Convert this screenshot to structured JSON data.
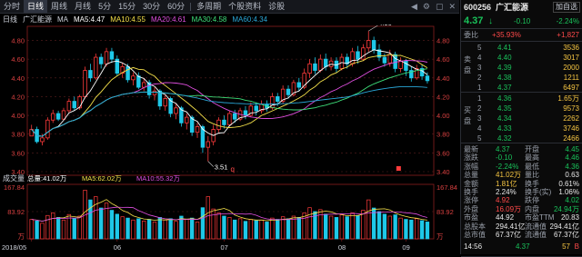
{
  "toolbar": {
    "tabs": [
      "分时",
      "日线",
      "周线",
      "月线",
      "5分",
      "15分",
      "30分",
      "60分",
      "多周期",
      "个股资料",
      "诊股"
    ],
    "active_index": 1
  },
  "info": {
    "period": "日线",
    "name": "广汇能源",
    "ma_label": "MA",
    "ma5": "MA5:4.47",
    "ma10": "MA10:4.55",
    "ma20": "MA20:4.61",
    "ma30": "MA30:4.58",
    "ma60": "MA60:4.34"
  },
  "colors": {
    "up": "#ff3b3b",
    "down": "#1ec8e8",
    "ma5": "#ffffff",
    "ma10": "#f5e14a",
    "ma20": "#e04fe0",
    "ma30": "#3ee07a",
    "ma60": "#2aa7d8"
  },
  "chart_data": {
    "type": "candlestick",
    "price_axis": [
      "4.80",
      "4.60",
      "4.40",
      "4.20",
      "4.00",
      "3.80",
      "3.60",
      "3.40"
    ],
    "price_axis_right": [
      "4.80",
      "4.60",
      "4.40",
      "4.20",
      "4.00",
      "3.80",
      "3.60",
      "3.40"
    ],
    "annotations": {
      "high": "4.90",
      "low": "3.51",
      "marker": "q"
    },
    "volume_title": "成交量",
    "volume_stats": {
      "vol": "总量:41.02万",
      "ma5": "MA5:62.02万",
      "ma10": "MA10:55.32万"
    },
    "volume_axis": [
      "167.84",
      "83.92",
      "万"
    ],
    "volume_axis_right": [
      "167.84",
      "83.92",
      "万"
    ],
    "x_labels": [
      "2018/05",
      "06",
      "07",
      "08",
      "09"
    ],
    "candles": [
      [
        3.78,
        3.85,
        3.82,
        3.9
      ],
      [
        3.85,
        3.72,
        3.7,
        3.88
      ],
      [
        3.72,
        3.76,
        3.68,
        3.8
      ],
      [
        3.76,
        3.95,
        3.74,
        3.98
      ],
      [
        3.95,
        4.02,
        3.92,
        4.06
      ],
      [
        4.02,
        3.96,
        3.94,
        4.05
      ],
      [
        3.96,
        4.05,
        3.95,
        4.08
      ],
      [
        4.05,
        4.15,
        4.02,
        4.18
      ],
      [
        4.15,
        4.08,
        4.05,
        4.2
      ],
      [
        4.08,
        4.2,
        4.06,
        4.22
      ],
      [
        4.2,
        4.48,
        4.18,
        4.52
      ],
      [
        4.48,
        4.4,
        4.36,
        4.55
      ],
      [
        4.4,
        4.62,
        4.38,
        4.66
      ],
      [
        4.62,
        4.55,
        4.5,
        4.66
      ],
      [
        4.55,
        4.68,
        4.52,
        4.72
      ],
      [
        4.68,
        4.6,
        4.56,
        4.72
      ],
      [
        4.6,
        4.45,
        4.42,
        4.64
      ],
      [
        4.45,
        4.52,
        4.4,
        4.56
      ],
      [
        4.52,
        4.38,
        4.35,
        4.55
      ],
      [
        4.38,
        4.42,
        4.32,
        4.46
      ],
      [
        4.42,
        4.3,
        4.28,
        4.46
      ],
      [
        4.3,
        4.35,
        4.26,
        4.4
      ],
      [
        4.35,
        4.22,
        4.18,
        4.38
      ],
      [
        4.22,
        4.26,
        4.16,
        4.3
      ],
      [
        4.26,
        4.1,
        4.06,
        4.28
      ],
      [
        4.1,
        4.18,
        4.05,
        4.22
      ],
      [
        4.18,
        4.02,
        3.98,
        4.2
      ],
      [
        4.02,
        4.08,
        3.96,
        4.12
      ],
      [
        4.08,
        3.92,
        3.88,
        4.1
      ],
      [
        3.92,
        3.98,
        3.85,
        4.02
      ],
      [
        3.98,
        3.82,
        3.78,
        4.0
      ],
      [
        3.82,
        3.88,
        3.76,
        3.92
      ],
      [
        3.88,
        3.66,
        3.6,
        3.9
      ],
      [
        3.66,
        3.72,
        3.51,
        3.78
      ],
      [
        3.72,
        3.85,
        3.68,
        3.9
      ],
      [
        3.85,
        3.95,
        3.82,
        3.98
      ],
      [
        3.95,
        3.9,
        3.86,
        4.0
      ],
      [
        3.9,
        4.02,
        3.88,
        4.05
      ],
      [
        4.02,
        3.96,
        3.92,
        4.06
      ],
      [
        3.96,
        4.05,
        3.94,
        4.08
      ],
      [
        4.05,
        4.0,
        3.96,
        4.1
      ],
      [
        4.0,
        4.1,
        3.98,
        4.14
      ],
      [
        4.1,
        4.05,
        4.0,
        4.14
      ],
      [
        4.05,
        4.12,
        4.02,
        4.16
      ],
      [
        4.12,
        4.08,
        4.04,
        4.16
      ],
      [
        4.08,
        4.2,
        4.06,
        4.24
      ],
      [
        4.2,
        4.15,
        4.1,
        4.24
      ],
      [
        4.15,
        4.28,
        4.12,
        4.32
      ],
      [
        4.28,
        4.22,
        4.18,
        4.32
      ],
      [
        4.22,
        4.35,
        4.2,
        4.38
      ],
      [
        4.35,
        4.3,
        4.26,
        4.4
      ],
      [
        4.3,
        4.45,
        4.28,
        4.5
      ],
      [
        4.45,
        4.55,
        4.4,
        4.6
      ],
      [
        4.55,
        4.48,
        4.44,
        4.62
      ],
      [
        4.48,
        4.6,
        4.46,
        4.65
      ],
      [
        4.6,
        4.52,
        4.48,
        4.66
      ],
      [
        4.52,
        4.58,
        4.48,
        4.62
      ],
      [
        4.58,
        4.5,
        4.46,
        4.62
      ],
      [
        4.5,
        4.62,
        4.48,
        4.66
      ],
      [
        4.62,
        4.55,
        4.5,
        4.66
      ],
      [
        4.55,
        4.68,
        4.52,
        4.72
      ],
      [
        4.68,
        4.6,
        4.55,
        4.74
      ],
      [
        4.6,
        4.72,
        4.58,
        4.76
      ],
      [
        4.72,
        4.8,
        4.68,
        4.9
      ],
      [
        4.8,
        4.7,
        4.66,
        4.84
      ],
      [
        4.7,
        4.62,
        4.58,
        4.76
      ],
      [
        4.62,
        4.56,
        4.52,
        4.66
      ],
      [
        4.56,
        4.65,
        4.52,
        4.7
      ],
      [
        4.65,
        4.5,
        4.46,
        4.68
      ],
      [
        4.5,
        4.58,
        4.46,
        4.62
      ],
      [
        4.58,
        4.48,
        4.42,
        4.6
      ],
      [
        4.48,
        4.4,
        4.36,
        4.52
      ],
      [
        4.4,
        4.5,
        4.38,
        4.54
      ],
      [
        4.5,
        4.42,
        4.38,
        4.54
      ],
      [
        4.42,
        4.37,
        4.34,
        4.46
      ]
    ],
    "volumes": [
      60,
      55,
      48,
      72,
      80,
      66,
      58,
      75,
      62,
      70,
      150,
      120,
      130,
      95,
      110,
      88,
      76,
      68,
      64,
      58,
      62,
      55,
      60,
      52,
      66,
      58,
      62,
      54,
      70,
      60,
      64,
      52,
      96,
      130,
      92,
      80,
      70,
      66,
      58,
      62,
      54,
      60,
      56,
      58,
      52,
      64,
      60,
      68,
      62,
      70,
      66,
      80,
      96,
      84,
      90,
      76,
      70,
      66,
      74,
      68,
      80,
      72,
      88,
      120,
      95,
      84,
      76,
      70,
      74,
      64,
      60,
      58,
      62,
      56,
      52
    ]
  },
  "panel": {
    "code": "600256",
    "name": "广汇能源",
    "watch_label": "加自选",
    "price": "4.37",
    "arrow": "↓",
    "change": "-0.10",
    "change_pct": "-2.24%",
    "weibi_label": "委比",
    "weibi_value": "+35.93%",
    "weibi_diff": "+1,827",
    "sell_label": "卖盘",
    "sell_levels": [
      {
        "n": "5",
        "p": "4.41",
        "v": "3536"
      },
      {
        "n": "4",
        "p": "4.40",
        "v": "3017"
      },
      {
        "n": "3",
        "p": "4.39",
        "v": "2000"
      },
      {
        "n": "2",
        "p": "4.38",
        "v": "1211"
      },
      {
        "n": "1",
        "p": "4.37",
        "v": "6497"
      }
    ],
    "buy_label": "买盘",
    "buy_levels": [
      {
        "n": "1",
        "p": "4.36",
        "v": "1.65万"
      },
      {
        "n": "2",
        "p": "4.35",
        "v": "9573"
      },
      {
        "n": "3",
        "p": "4.34",
        "v": "2262"
      },
      {
        "n": "4",
        "p": "4.33",
        "v": "3746"
      },
      {
        "n": "5",
        "p": "4.32",
        "v": "2466"
      }
    ],
    "stats": [
      {
        "l1": "最新",
        "v1": "4.37",
        "c1": "green",
        "l2": "开盘",
        "v2": "4.45",
        "c2": "green"
      },
      {
        "l1": "涨跌",
        "v1": "-0.10",
        "c1": "green",
        "l2": "最高",
        "v2": "4.46",
        "c2": "green"
      },
      {
        "l1": "涨幅",
        "v1": "-2.24%",
        "c1": "green",
        "l2": "最低",
        "v2": "4.36",
        "c2": "green"
      },
      {
        "l1": "总量",
        "v1": "41.02万",
        "c1": "yellow",
        "l2": "量比",
        "v2": "0.63",
        "c2": "white"
      },
      {
        "l1": "金额",
        "v1": "1.81亿",
        "c1": "yellow",
        "l2": "换手",
        "v2": "0.61%",
        "c2": "white"
      },
      {
        "l1": "换手",
        "v1": "2.24%",
        "c1": "white",
        "l2": "换手(实)",
        "v2": "1.06%",
        "c2": "white"
      },
      {
        "l1": "涨停",
        "v1": "4.92",
        "c1": "red",
        "l2": "跌停",
        "v2": "4.02",
        "c2": "green"
      },
      {
        "l1": "外盘",
        "v1": "16.09万",
        "c1": "red",
        "l2": "内盘",
        "v2": "24.94万",
        "c2": "green"
      },
      {
        "l1": "市盈",
        "v1": "44.92",
        "c1": "white",
        "l2": "市盈TTM",
        "v2": "20.83",
        "c2": "white"
      },
      {
        "l1": "总股本",
        "v1": "294.41亿",
        "c1": "white",
        "l2": "流通值",
        "v2": "294.41亿",
        "c2": "white"
      },
      {
        "l1": "总市值",
        "v1": "67.37亿",
        "c1": "white",
        "l2": "流通值",
        "v2": "67.37亿",
        "c2": "white"
      }
    ],
    "tick": {
      "time": "14:56",
      "price": "4.37",
      "vol": "57",
      "dir": "B"
    }
  }
}
